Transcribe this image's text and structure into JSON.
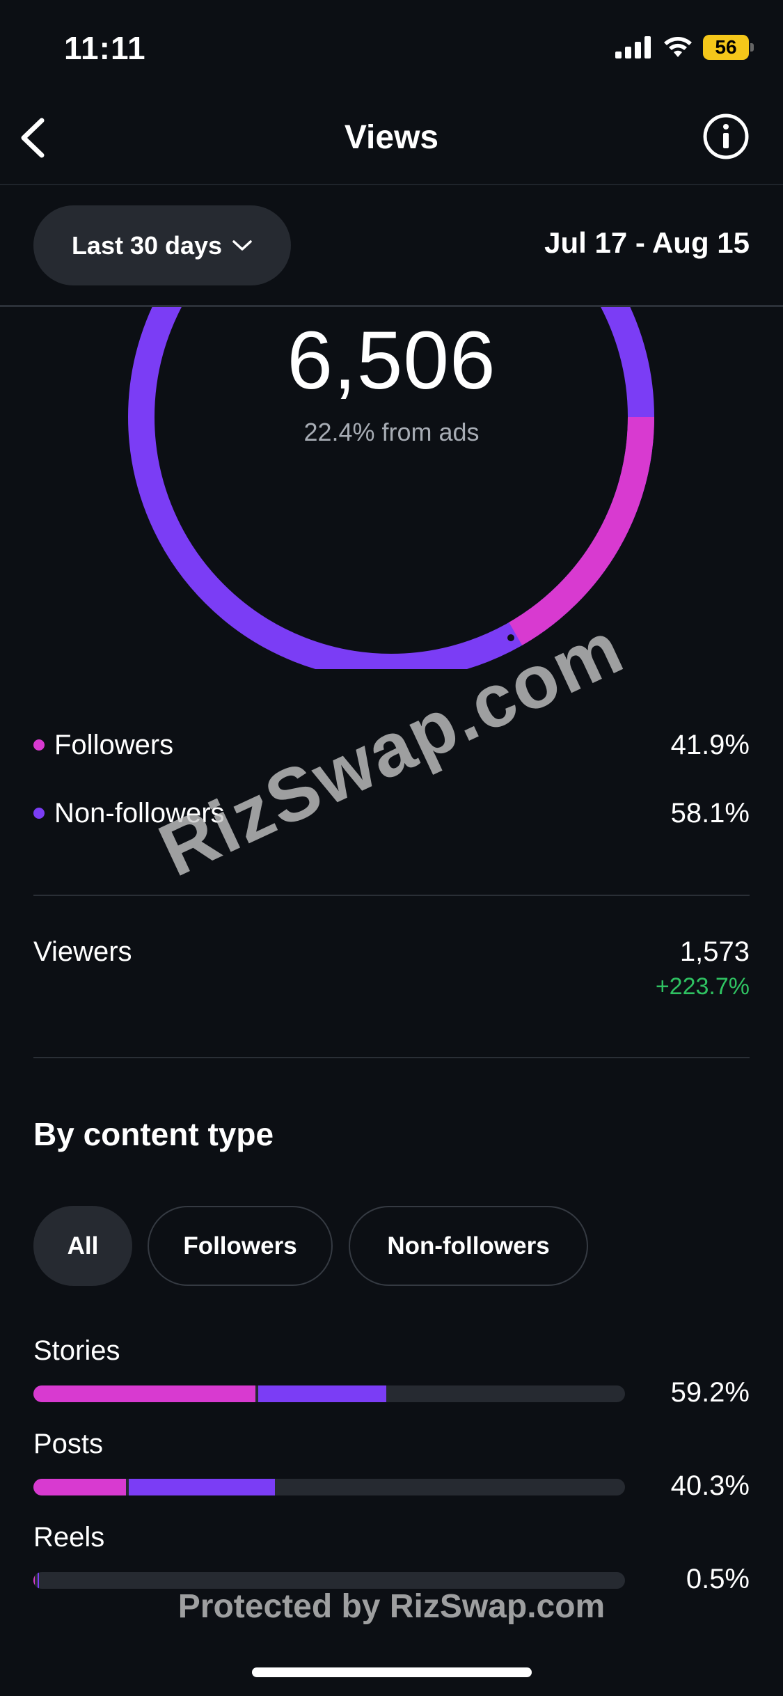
{
  "status_bar": {
    "time": "11:11",
    "battery": "56"
  },
  "nav": {
    "title": "Views"
  },
  "filter": {
    "range_label": "Last 30 days",
    "date_range": "Jul 17 - Aug 15"
  },
  "summary": {
    "total_views": "6,506",
    "ads_note": "22.4% from ads"
  },
  "split": [
    {
      "label": "Followers",
      "value": "41.9%",
      "color": "#d83ad0"
    },
    {
      "label": "Non-followers",
      "value": "58.1%",
      "color": "#7b3df5"
    }
  ],
  "viewers": {
    "label": "Viewers",
    "value": "1,573",
    "change": "+223.7%"
  },
  "content_type": {
    "title": "By content type",
    "tabs": [
      "All",
      "Followers",
      "Non-followers"
    ],
    "selected_tab": "All",
    "items": [
      {
        "label": "Stories",
        "value": "59.2%",
        "followers_fraction": 0.375,
        "nonfollowers_fraction": 0.217
      },
      {
        "label": "Posts",
        "value": "40.3%",
        "followers_fraction": 0.156,
        "nonfollowers_fraction": 0.247
      },
      {
        "label": "Reels",
        "value": "0.5%",
        "followers_fraction": 0.002,
        "nonfollowers_fraction": 0.003
      }
    ]
  },
  "watermarks": {
    "diagonal": "RizSwap.com",
    "footer": "Protected by RizSwap.com"
  },
  "colors": {
    "followers": "#d83ad0",
    "nonfollowers": "#7b3df5",
    "positive": "#2fc262"
  }
}
